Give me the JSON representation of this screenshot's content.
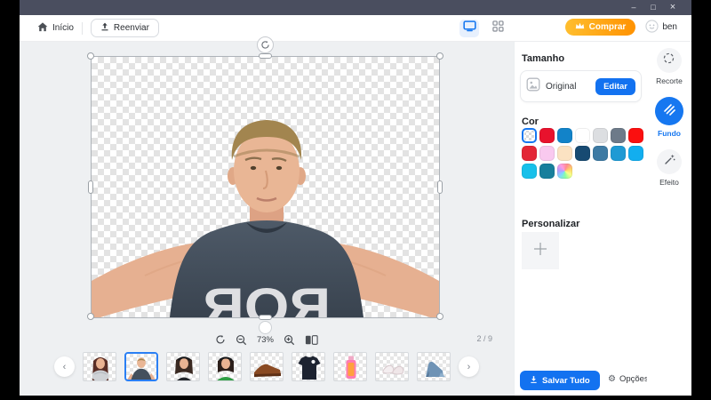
{
  "titlebar": {
    "minimize": "–",
    "maximize": "□",
    "close": "×"
  },
  "toolbar": {
    "home_label": "Início",
    "reupload_label": "Reenviar",
    "buy_label": "Comprar",
    "user_name": "ben"
  },
  "canvas": {
    "zoom_percent": "73%",
    "counter": "2 / 9",
    "shirt_text": "ROR"
  },
  "panel": {
    "size_title": "Tamanho",
    "size_value": "Original",
    "edit_label": "Editar",
    "color_title": "Cor",
    "customize_title": "Personalizar",
    "save_label": "Salvar Tudo",
    "options_label": "Opções",
    "swatches": [
      "transparent",
      "#e8122d",
      "#1283c9",
      "#ffffff",
      "#dcdee1",
      "#6d7a89",
      "#fb0f0f",
      "#e32636",
      "#f9c9ef",
      "#fbe2c2",
      "#174a72",
      "#3d7aa3",
      "#1e9ad4",
      "#12aeef",
      "#18c0ea",
      "#177f9c",
      "rainbow"
    ]
  },
  "rail": {
    "crop_label": "Recorte",
    "background_label": "Fundo",
    "effect_label": "Efeito"
  },
  "nav": {
    "prev": "‹",
    "next": "›"
  },
  "thumbnails": [
    "woman-with-scarf",
    "selfie-man-selected",
    "woman-with-headphones",
    "woman-in-green",
    "brown-shoe",
    "black-t-shirt",
    "perfume-bottle",
    "white-sandals",
    "blue-high-heel"
  ],
  "colors": {
    "accent_blue": "#1372f0",
    "titlebar": "#4a4e5f",
    "buy_gradient_start": "#ffbe2e",
    "buy_gradient_end": "#ff9201",
    "selection_border": "#2a7ff4"
  }
}
